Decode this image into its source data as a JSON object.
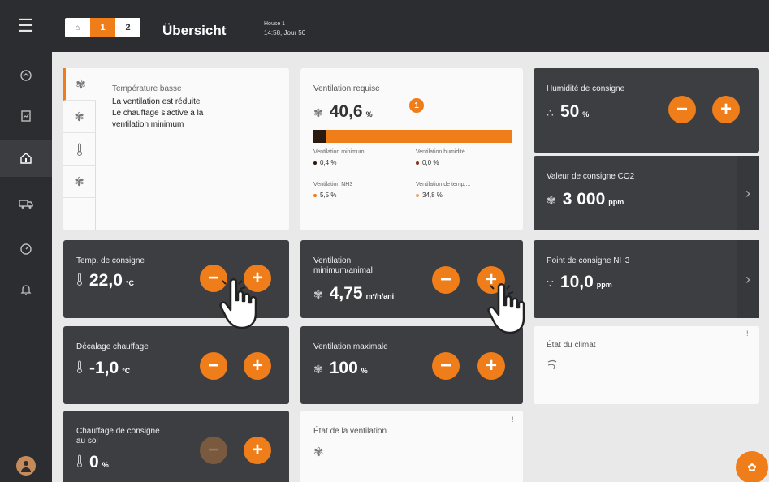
{
  "header": {
    "tabs": [
      {
        "label": "⌂"
      },
      {
        "label": "1"
      },
      {
        "label": "2"
      }
    ],
    "title": "Übersicht",
    "house_name": "House 1",
    "house_time": "14:58, Jour 50"
  },
  "alarm": {
    "title": "Température basse",
    "lines": [
      "La ventilation est réduite",
      "Le chauffage s'active à la",
      "ventilation minimum"
    ]
  },
  "ventilation_required": {
    "label": "Ventilation requise",
    "value": "40,6",
    "unit": "%",
    "badge": "1",
    "level": 0.06,
    "items": [
      {
        "label": "Ventilation minimum",
        "value": "0,4 %",
        "color": "#2b1a10"
      },
      {
        "label": "Ventilation humidité",
        "value": "0,0 %",
        "color": "#8a2f1b"
      },
      {
        "label": "Ventilation NH3",
        "value": "5,5 %",
        "color": "#ef7d1a"
      },
      {
        "label": "Ventilation de temp....",
        "value": "34,8 %",
        "color": "#f5a25a"
      }
    ]
  },
  "humidity": {
    "label": "Humidité de consigne",
    "value": "50",
    "unit": "%"
  },
  "co2": {
    "label": "Valeur de consigne CO2",
    "value": "3 000",
    "unit": "ppm"
  },
  "temp": {
    "label": "Temp. de consigne",
    "value": "22,0",
    "unit": "°C"
  },
  "vent_min": {
    "label1": "Ventilation",
    "label2": "minimum/animal",
    "value": "4,75",
    "unit": "m³/h/ani"
  },
  "nh3": {
    "label": "Point de consigne NH3",
    "value": "10,0",
    "unit": "ppm"
  },
  "heat_offset": {
    "label": "Décalage chauffage",
    "value": "-1,0",
    "unit": "°C"
  },
  "vent_max": {
    "label": "Ventilation maximale",
    "value": "100",
    "unit": "%"
  },
  "climate_state": {
    "label": "État du climat",
    "mark": "!"
  },
  "floor_heat": {
    "label1": "Chauffage de consigne",
    "label2": "au sol",
    "value": "0",
    "unit": "%"
  },
  "vent_state": {
    "label": "État de la ventilation",
    "mark": "!"
  },
  "buttons": {
    "minus": "−",
    "plus": "+"
  },
  "colors": {
    "accent": "#ef7d1a",
    "dark_card": "#3c3e42",
    "sidebar": "#2b2d30"
  }
}
